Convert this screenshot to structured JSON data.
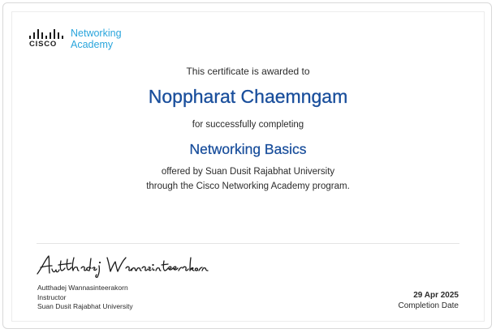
{
  "logo": {
    "brand": "CISCO",
    "line1": "Networking",
    "line2": "Academy"
  },
  "certificate": {
    "awarded_text": "This certificate is awarded to",
    "recipient_name": "Noppharat Chaemngam",
    "completing_text": "for successfully completing",
    "course_name": "Networking Basics",
    "offered_line1": "offered by Suan Dusit Rajabhat University",
    "offered_line2": "through the Cisco Networking Academy program."
  },
  "instructor": {
    "name": "Autthadej Wannasinteerakorn",
    "role": "Instructor",
    "institution": "Suan Dusit Rajabhat University"
  },
  "completion": {
    "date": "29 Apr 2025",
    "label": "Completion Date"
  },
  "colors": {
    "accent_blue": "#1a4f9c",
    "academy_blue": "#2aa5dc",
    "text": "#2b2b2b"
  }
}
